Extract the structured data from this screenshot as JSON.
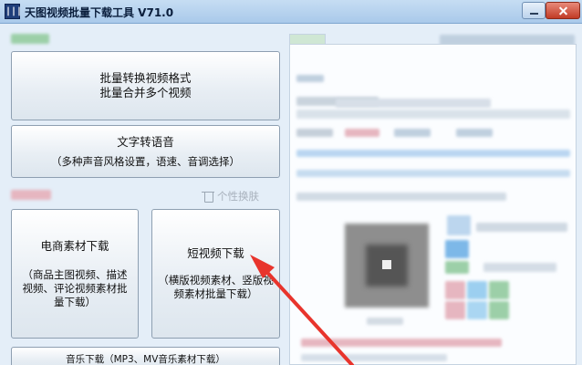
{
  "window": {
    "title": "天图视频批量下载工具 V71.0",
    "icon_text": "|||"
  },
  "buttons": {
    "convert": {
      "line1": "批量转换视频格式",
      "line2": "批量合并多个视频"
    },
    "tts": {
      "line1": "文字转语音",
      "line2": "（多种声音风格设置，语速、音调选择）"
    },
    "ecommerce": {
      "line1": "电商素材下载",
      "line2": "（商品主图视频、描述视频、评论视频素材批量下载）"
    },
    "short_video": {
      "line1": "短视频下载",
      "line2": "（横版视频素材、竖版视频素材批量下载）"
    },
    "music": {
      "line1": "音乐下载（MP3、MV音乐素材下载）"
    }
  },
  "skin": {
    "label": "个性换肤",
    "icon": "shirt-icon"
  },
  "annotation": {
    "color": "#e8342c"
  }
}
